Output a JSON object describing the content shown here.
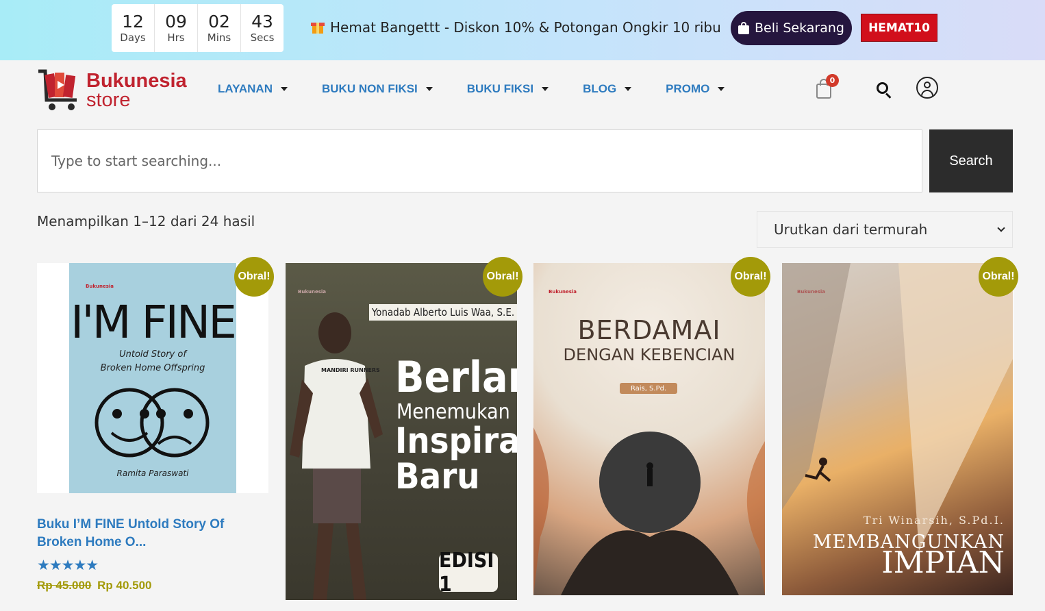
{
  "countdown": [
    {
      "value": "12",
      "unit": "Days"
    },
    {
      "value": "09",
      "unit": "Hrs"
    },
    {
      "value": "02",
      "unit": "Mins"
    },
    {
      "value": "43",
      "unit": "Secs"
    }
  ],
  "promo": {
    "text": "Hemat Bangettt - Diskon 10% & Potongan Ongkir 10 ribu",
    "cta_label": "Beli Sekarang",
    "coupon_code": "HEMAT10"
  },
  "logo": {
    "line1": "Bukunesia",
    "line2": "store"
  },
  "nav": [
    {
      "label": "LAYANAN"
    },
    {
      "label": "BUKU NON FIKSI"
    },
    {
      "label": "BUKU FIKSI"
    },
    {
      "label": "BLOG"
    },
    {
      "label": "PROMO"
    }
  ],
  "cart": {
    "count": "0"
  },
  "search": {
    "placeholder": "Type to start searching...",
    "button_label": "Search"
  },
  "results": {
    "count_text": "Menampilkan 1–12 dari 24 hasil",
    "sort_selected": "Urutkan dari termurah"
  },
  "products": [
    {
      "badge": "Obral!",
      "cover": {
        "publisher": "Bukunesia",
        "title": "I'M FINE",
        "subtitle_1": "Untold Story of",
        "subtitle_2": "Broken Home Offspring",
        "author": "Ramita Paraswati"
      },
      "title": "Buku I’M FINE Untold Story Of Broken Home O...",
      "rating": 5,
      "stars": "★★★★★",
      "price_old": "Rp 45.000",
      "price_new": "Rp 40.500"
    },
    {
      "badge": "Obral!",
      "cover": {
        "publisher": "Bukunesia",
        "author": "Yonadab Alberto Luis Waa, S.E.",
        "t1": "Berlari",
        "t2": "Menemukan",
        "t3": "Inspirasi",
        "t4": "Baru",
        "edition": "EDISI 1",
        "shirt": "MANDIRI RUNNERS"
      }
    },
    {
      "badge": "Obral!",
      "cover": {
        "publisher": "Bukunesia",
        "t1": "BERDAMAI",
        "t2": "DENGAN KEBENCIAN",
        "author": "Rais, S.Pd."
      }
    },
    {
      "badge": "Obral!",
      "cover": {
        "publisher": "Bukunesia",
        "author": "Tri Winarsih, S.Pd.I.",
        "t1": "MEMBANGUNKAN",
        "t2": "IMPIAN"
      }
    }
  ],
  "colors": {
    "brand_red": "#c0232f",
    "link_blue": "#2e7bbf",
    "sale_olive": "#a39a09",
    "cta_dark": "#25163e",
    "coupon_red": "#d10f1b"
  }
}
